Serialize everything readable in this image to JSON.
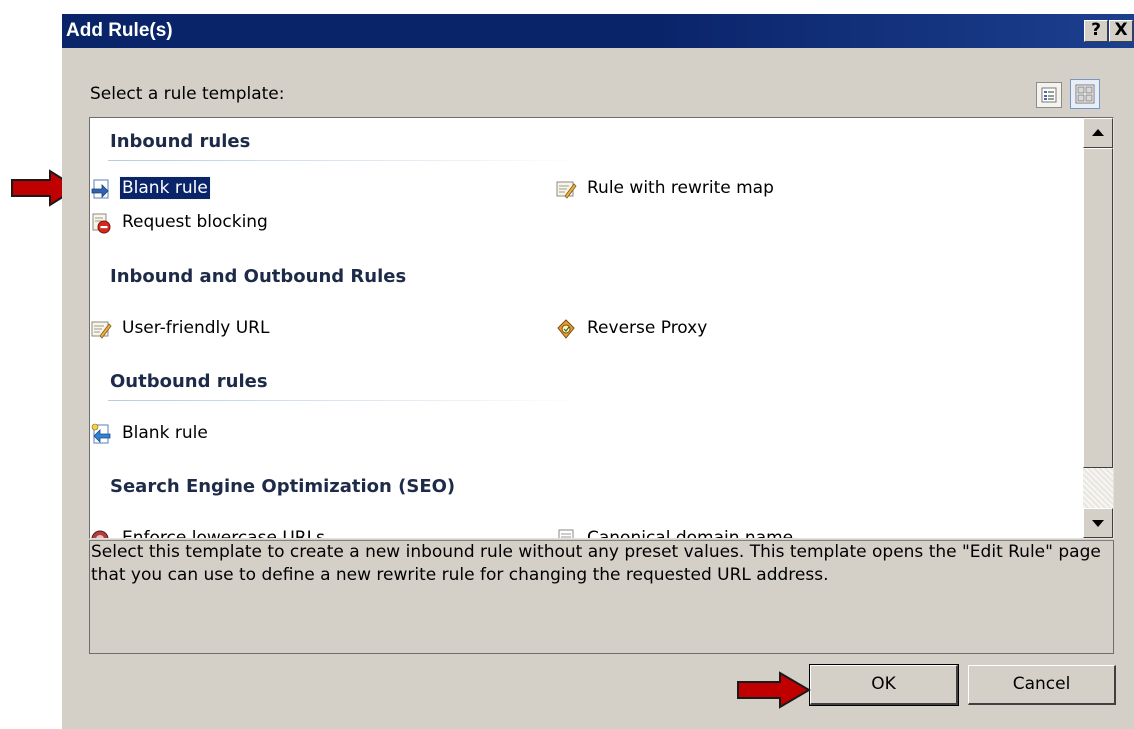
{
  "dialog": {
    "title": "Add Rule(s)",
    "help_button": "?",
    "close_button": "X",
    "prompt": "Select a rule template:",
    "view_buttons": [
      "list-view-icon",
      "tile-view-icon"
    ]
  },
  "groups": [
    {
      "header": "Inbound rules",
      "items": [
        {
          "label": "Blank rule",
          "icon": "inbound-blank-rule-icon",
          "selected": true
        },
        {
          "label": "Rule with rewrite map",
          "icon": "rewrite-map-icon"
        },
        {
          "label": "Request blocking",
          "icon": "request-blocking-icon"
        }
      ]
    },
    {
      "header": "Inbound and Outbound Rules",
      "items": [
        {
          "label": "User-friendly URL",
          "icon": "user-friendly-url-icon"
        },
        {
          "label": "Reverse Proxy",
          "icon": "reverse-proxy-icon"
        }
      ]
    },
    {
      "header": "Outbound rules",
      "items": [
        {
          "label": "Blank rule",
          "icon": "outbound-blank-rule-icon"
        }
      ]
    },
    {
      "header": "Search Engine Optimization (SEO)",
      "items": [
        {
          "label": "Enforce lowercase URLs",
          "icon": "lowercase-url-icon"
        },
        {
          "label": "Canonical domain name",
          "icon": "canonical-domain-icon"
        }
      ]
    }
  ],
  "description": "Select this template to create a new inbound rule without any preset values. This template opens the \"Edit Rule\" page that you can use to define a new rewrite rule for changing the requested URL address.",
  "buttons": {
    "ok": "OK",
    "cancel": "Cancel"
  },
  "colors": {
    "titlebar": "#0a246a",
    "selection": "#0a246a",
    "annotation_arrow": "#c00000"
  }
}
